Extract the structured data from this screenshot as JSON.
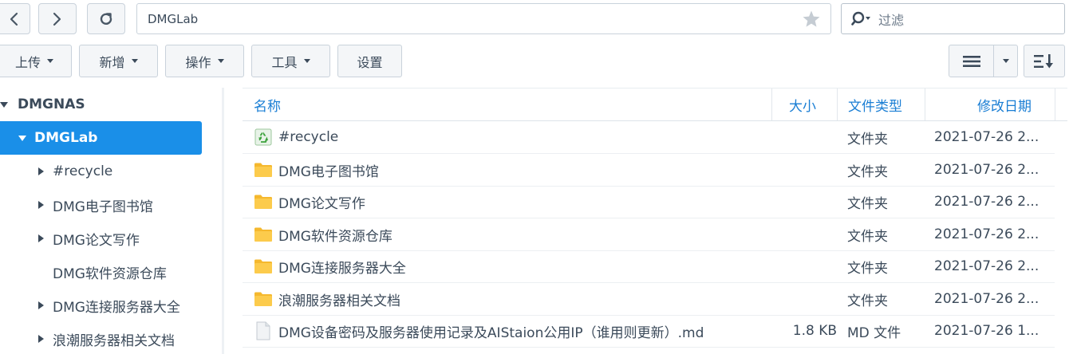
{
  "path": "DMGLab",
  "filter": {
    "placeholder": "过滤"
  },
  "toolbar": {
    "upload": "上传",
    "new": "新增",
    "action": "操作",
    "tools": "工具",
    "settings": "设置"
  },
  "sidebar": {
    "root": "DMGNAS",
    "selected": "DMGLab",
    "children": [
      {
        "label": "#recycle",
        "expandable": true
      },
      {
        "label": "DMG电子图书馆",
        "expandable": true
      },
      {
        "label": "DMG论文写作",
        "expandable": true
      },
      {
        "label": "DMG软件资源仓库",
        "expandable": false
      },
      {
        "label": "DMG连接服务器大全",
        "expandable": true
      },
      {
        "label": "浪潮服务器相关文档",
        "expandable": true
      }
    ]
  },
  "columns": {
    "name": "名称",
    "size": "大小",
    "type": "文件类型",
    "modified": "修改日期"
  },
  "files": [
    {
      "name": "#recycle",
      "icon": "recycle-bin-icon",
      "size": "",
      "type": "文件夹",
      "modified": "2021-07-26 2..."
    },
    {
      "name": "DMG电子图书馆",
      "icon": "folder-icon",
      "size": "",
      "type": "文件夹",
      "modified": "2021-07-26 2..."
    },
    {
      "name": "DMG论文写作",
      "icon": "folder-icon",
      "size": "",
      "type": "文件夹",
      "modified": "2021-07-26 2..."
    },
    {
      "name": "DMG软件资源仓库",
      "icon": "folder-icon",
      "size": "",
      "type": "文件夹",
      "modified": "2021-07-26 2..."
    },
    {
      "name": "DMG连接服务器大全",
      "icon": "folder-icon",
      "size": "",
      "type": "文件夹",
      "modified": "2021-07-26 2..."
    },
    {
      "name": "浪潮服务器相关文档",
      "icon": "folder-icon",
      "size": "",
      "type": "文件夹",
      "modified": "2021-07-26 2..."
    },
    {
      "name": "DMG设备密码及服务器使用记录及AIStaion公用IP（谁用则更新）.md",
      "icon": "document-icon",
      "size": "1.8 KB",
      "type": "MD 文件",
      "modified": "2021-07-26 1..."
    }
  ],
  "colors": {
    "accent": "#1a8fe8",
    "header_text": "#1a7ed4",
    "folder": "#f5b82e",
    "recycle": "#4caf50"
  }
}
